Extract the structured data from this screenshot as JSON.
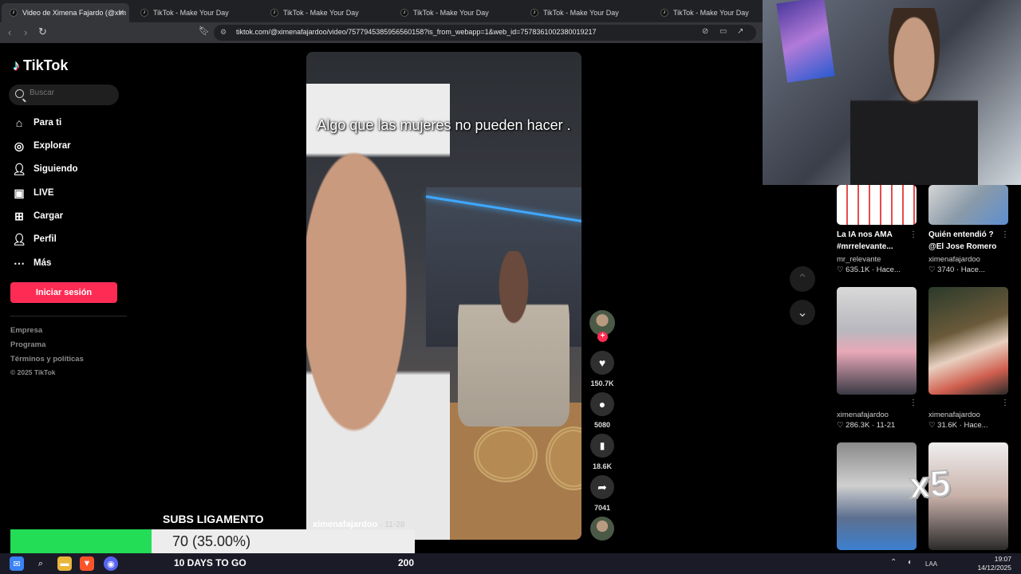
{
  "tabs": [
    {
      "label": "Video de Ximena Fajardo (@xim",
      "active": true
    },
    {
      "label": "TikTok - Make Your Day",
      "active": false
    },
    {
      "label": "TikTok - Make Your Day",
      "active": false
    },
    {
      "label": "TikTok - Make Your Day",
      "active": false
    },
    {
      "label": "TikTok - Make Your Day",
      "active": false
    },
    {
      "label": "TikTok - Make Your Day",
      "active": false
    }
  ],
  "address": {
    "url": "tiktok.com/@ximenafajardoo/video/7577945385956560158?is_from_webapp=1&web_id=7578361002380019217"
  },
  "sidebar": {
    "logo": "TikTok",
    "search_placeholder": "Buscar",
    "items": [
      {
        "label": "Para ti",
        "icon": "home-icon"
      },
      {
        "label": "Explorar",
        "icon": "compass-icon"
      },
      {
        "label": "Siguiendo",
        "icon": "following-icon"
      },
      {
        "label": "LIVE",
        "icon": "live-icon"
      },
      {
        "label": "Cargar",
        "icon": "upload-icon"
      },
      {
        "label": "Perfil",
        "icon": "profile-icon"
      },
      {
        "label": "Más",
        "icon": "more-icon"
      }
    ],
    "login": "Iniciar sesión",
    "footer": [
      "Empresa",
      "Programa",
      "Términos y políticas"
    ],
    "copyright": "© 2025 TikTok"
  },
  "video": {
    "caption": "Algo que las mujeres no pueden hacer .",
    "author": "ximenafajardoo",
    "date": "· 11-28"
  },
  "actions": {
    "likes": "150.7K",
    "comments": "5080",
    "saves": "18.6K",
    "shares": "7041"
  },
  "recommendations": [
    {
      "title": "La IA nos AMA #mrrelevante...",
      "author": "mr_relevante",
      "likes": "635.1K",
      "date": "Hace..."
    },
    {
      "title": "Quién entendió ? @El Jose Romero",
      "author": "ximenafajardoo",
      "likes": "3740",
      "date": "Hace..."
    },
    {
      "title": "",
      "author": "ximenafajardoo",
      "likes": "286.3K",
      "date": "11-21"
    },
    {
      "title": "",
      "author": "ximenafajardoo",
      "likes": "31.6K",
      "date": "Hace..."
    }
  ],
  "overlay": {
    "subs_title": "SUBS LIGAMENTO",
    "progress_text": "70 (35.00%)",
    "progress_fraction": 0.35,
    "days_to_go": "10 DAYS TO GO",
    "goal": "200",
    "multiplier": "x5"
  },
  "taskbar": {
    "lang": "LAA",
    "time": "19:07",
    "date": "14/12/2025"
  },
  "colors": {
    "brand": "#fe2c55",
    "progress": "#22dd55"
  }
}
